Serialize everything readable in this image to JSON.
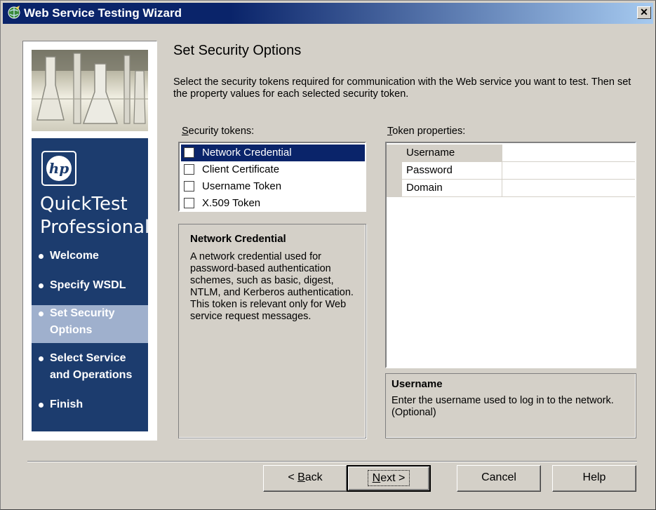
{
  "window": {
    "title": "Web Service Testing Wizard",
    "close_glyph": "✕",
    "icon": "wizard-globe-icon"
  },
  "sidebar": {
    "brand_line1": "QuickTest",
    "brand_line2": "Professional",
    "logo_text": "hp",
    "steps": [
      {
        "label": "Welcome",
        "active": false
      },
      {
        "label": "Specify WSDL",
        "active": false
      },
      {
        "label": "Set Security Options",
        "active": true
      },
      {
        "label": "Select Service and Operations",
        "active": false
      },
      {
        "label": "Finish",
        "active": false
      }
    ]
  },
  "main": {
    "heading": "Set Security Options",
    "description": "Select the security tokens required for communication with the Web service you want to test. Then set the property values for each selected security token."
  },
  "tokens": {
    "label_key": "S",
    "label_rest": "ecurity tokens:",
    "items": [
      {
        "label": "Network Credential",
        "checked": false,
        "selected": true
      },
      {
        "label": "Client Certificate",
        "checked": false,
        "selected": false
      },
      {
        "label": "Username Token",
        "checked": false,
        "selected": false
      },
      {
        "label": "X.509 Token",
        "checked": false,
        "selected": false
      }
    ],
    "info_title": "Network Credential",
    "info_body": "A network credential used for password-based authentication schemes, such as basic, digest, NTLM, and Kerberos authentication. This token is relevant only for Web service request messages."
  },
  "properties": {
    "label_key": "T",
    "label_rest": "oken properties:",
    "rows": [
      {
        "name": "Username",
        "value": ""
      },
      {
        "name": "Password",
        "value": ""
      },
      {
        "name": "Domain",
        "value": ""
      }
    ],
    "info_title": "Username",
    "info_body": "Enter the username used to log in to the network. (Optional)"
  },
  "buttons": {
    "back_key": "B",
    "back_prefix": "< ",
    "back_rest": "ack",
    "next_key": "N",
    "next_rest": "ext >",
    "cancel": "Cancel",
    "help": "Help"
  },
  "colors": {
    "title_bar": "#0a246a",
    "sidebar_blue": "#1c3c6e",
    "selection": "#0a246a",
    "active_step": "#9fb0cd",
    "face": "#d4d0c8"
  }
}
